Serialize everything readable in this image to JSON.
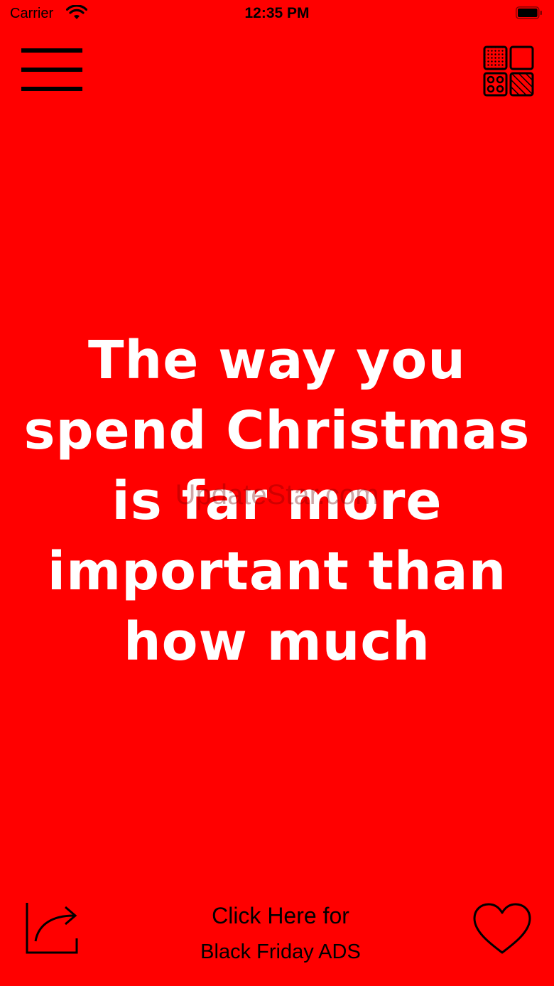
{
  "status_bar": {
    "carrier": "Carrier",
    "time": "12:35 PM"
  },
  "icons": {
    "menu": "hamburger-menu-icon",
    "themes": "pattern-grid-icon",
    "share": "share-icon",
    "favorite": "heart-icon",
    "wifi": "wifi-icon",
    "battery": "battery-icon"
  },
  "colors": {
    "background": "#ff0000",
    "quote_text": "#ffffff",
    "icons": "#000000"
  },
  "quote": {
    "text": "The way you spend Christmas is far more important than how much"
  },
  "watermark": "UpdateStar.com",
  "bottom_bar": {
    "ads_line1": "Click Here for",
    "ads_line2": "Black Friday ADS"
  }
}
